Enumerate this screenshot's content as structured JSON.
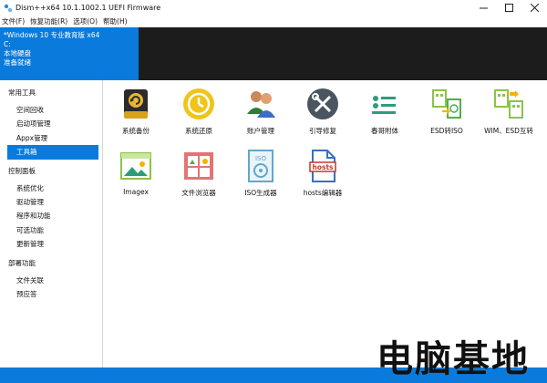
{
  "window": {
    "title": "Dism++x64 10.1.1002.1 UEFI Firmware",
    "minimize_icon": "minimize-icon",
    "maximize_icon": "maximize-icon",
    "close_icon": "close-icon"
  },
  "menu": {
    "items": [
      {
        "label": "文件(F)"
      },
      {
        "label": "恢复功能(R)"
      },
      {
        "label": "选项(O)"
      },
      {
        "label": "帮助(H)"
      }
    ]
  },
  "info": {
    "os": "*Windows 10 专业教育版 x64",
    "drive": "C:",
    "disk": "本地硬盘",
    "status": "准备就绪"
  },
  "sidebar": {
    "groups": [
      {
        "title": "常用工具",
        "items": [
          {
            "label": "空间回收"
          },
          {
            "label": "启动项管理"
          },
          {
            "label": "Appx管理"
          },
          {
            "label": "工具箱",
            "selected": true
          }
        ]
      },
      {
        "title": "控制面板",
        "items": [
          {
            "label": "系统优化"
          },
          {
            "label": "驱动管理"
          },
          {
            "label": "程序和功能"
          },
          {
            "label": "可选功能"
          },
          {
            "label": "更新管理"
          }
        ]
      },
      {
        "title": "部署功能",
        "items": [
          {
            "label": "文件关联"
          },
          {
            "label": "预应答"
          }
        ]
      }
    ]
  },
  "tools": [
    {
      "label": "系统备份",
      "icon": "backup-drive-icon"
    },
    {
      "label": "系统还原",
      "icon": "restore-clock-icon"
    },
    {
      "label": "账户管理",
      "icon": "users-icon"
    },
    {
      "label": "引导修复",
      "icon": "wrench-screwdriver-icon"
    },
    {
      "label": "春哥附体",
      "icon": "list-icon"
    },
    {
      "label": "ESD转ISO",
      "icon": "esd-iso-icon"
    },
    {
      "label": "WIM、ESD互转",
      "icon": "wim-esd-icon"
    },
    {
      "label": "Imagex",
      "icon": "image-icon"
    },
    {
      "label": "文件浏览器",
      "icon": "file-browser-icon"
    },
    {
      "label": "ISO生成器",
      "icon": "iso-disc-icon"
    },
    {
      "label": "hosts编辑器",
      "icon": "hosts-file-icon"
    }
  ],
  "watermark": {
    "text": "电脑基地"
  },
  "colors": {
    "accent": "#0a7bdc",
    "info_dark": "#1c1c1c"
  }
}
